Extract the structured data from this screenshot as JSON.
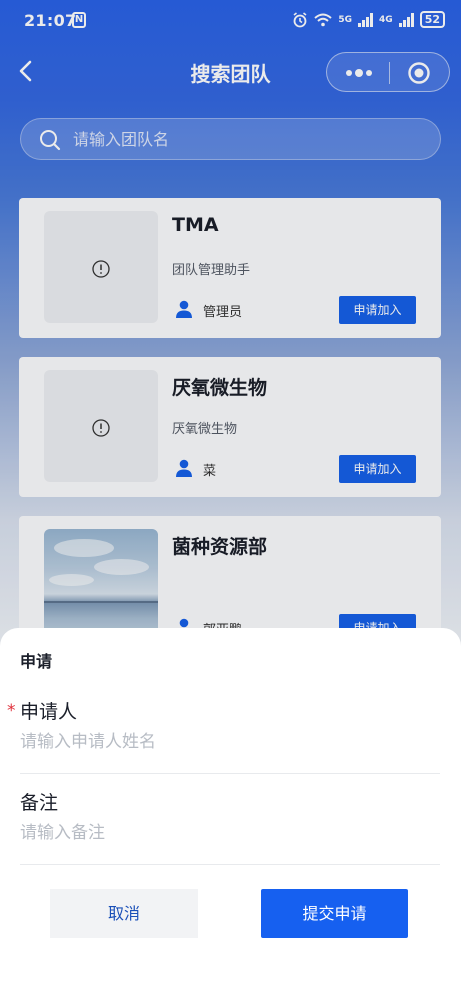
{
  "status_bar": {
    "time": "21:07",
    "n_badge": "N",
    "net1": "5G",
    "net2": "4G",
    "battery": "52"
  },
  "nav": {
    "title": "搜索团队",
    "back_icon": "chevron-left-icon",
    "more_icon": "more-dots-icon",
    "close_icon": "target-circle-icon"
  },
  "search": {
    "placeholder": "请输入团队名",
    "value": ""
  },
  "teams": [
    {
      "name": "TMA",
      "description": "团队管理助手",
      "member": "管理员",
      "button": "申请加入",
      "image": "image-error-icon"
    },
    {
      "name": "厌氧微生物",
      "description": "厌氧微生物",
      "member": "菜",
      "button": "申请加入",
      "image": "image-error-icon"
    },
    {
      "name": "菌种资源部",
      "description": "",
      "member": "郭亚鹏",
      "button": "申请加入",
      "image": "landscape-photo"
    }
  ],
  "sheet": {
    "title": "申请",
    "required_mark": "*",
    "applicant_label": "申请人",
    "applicant_placeholder": "请输入申请人姓名",
    "remark_label": "备注",
    "remark_placeholder": "请输入备注",
    "cancel_label": "取消",
    "submit_label": "提交申请"
  },
  "colors": {
    "primary": "#1660f0",
    "header_blue": "#2a62e6",
    "required": "#e0303b"
  }
}
